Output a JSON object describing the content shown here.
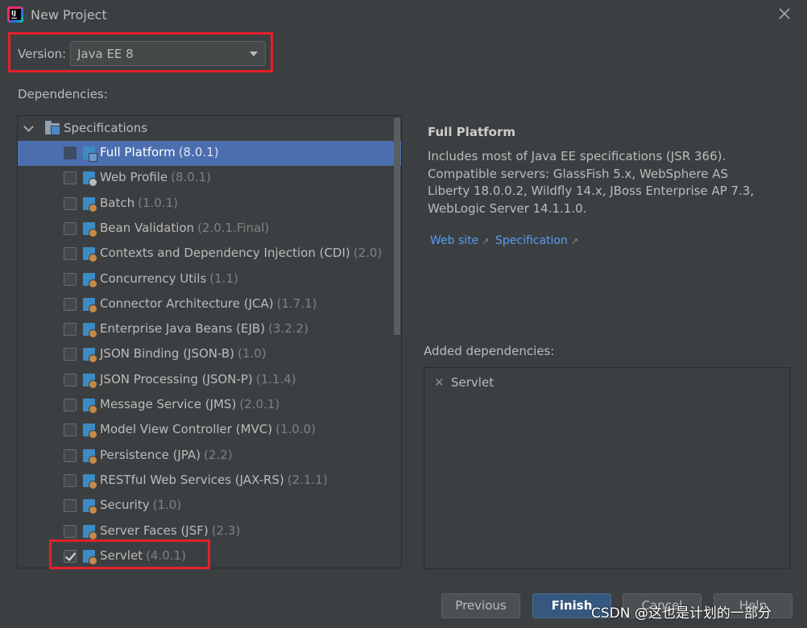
{
  "window": {
    "title": "New Project"
  },
  "version": {
    "label": "Version:",
    "value": "Java EE 8"
  },
  "dependencies_label": "Dependencies:",
  "tree": {
    "root_label": "Specifications",
    "items": [
      {
        "name": "Full Platform",
        "version": "(8.0.1)",
        "checked": false,
        "selected": true
      },
      {
        "name": "Web Profile",
        "version": "(8.0.1)",
        "checked": false,
        "selected": false
      },
      {
        "name": "Batch",
        "version": "(1.0.1)",
        "checked": false,
        "selected": false
      },
      {
        "name": "Bean Validation",
        "version": "(2.0.1.Final)",
        "checked": false,
        "selected": false
      },
      {
        "name": "Contexts and Dependency Injection (CDI)",
        "version": "(2.0)",
        "checked": false,
        "selected": false
      },
      {
        "name": "Concurrency Utils",
        "version": "(1.1)",
        "checked": false,
        "selected": false
      },
      {
        "name": "Connector Architecture (JCA)",
        "version": "(1.7.1)",
        "checked": false,
        "selected": false
      },
      {
        "name": "Enterprise Java Beans (EJB)",
        "version": "(3.2.2)",
        "checked": false,
        "selected": false
      },
      {
        "name": "JSON Binding (JSON-B)",
        "version": "(1.0)",
        "checked": false,
        "selected": false
      },
      {
        "name": "JSON Processing (JSON-P)",
        "version": "(1.1.4)",
        "checked": false,
        "selected": false
      },
      {
        "name": "Message Service (JMS)",
        "version": "(2.0.1)",
        "checked": false,
        "selected": false
      },
      {
        "name": "Model View Controller (MVC)",
        "version": "(1.0.0)",
        "checked": false,
        "selected": false
      },
      {
        "name": "Persistence (JPA)",
        "version": "(2.2)",
        "checked": false,
        "selected": false
      },
      {
        "name": "RESTful Web Services (JAX-RS)",
        "version": "(2.1.1)",
        "checked": false,
        "selected": false
      },
      {
        "name": "Security",
        "version": "(1.0)",
        "checked": false,
        "selected": false
      },
      {
        "name": "Server Faces (JSF)",
        "version": "(2.3)",
        "checked": false,
        "selected": false
      },
      {
        "name": "Servlet",
        "version": "(4.0.1)",
        "checked": true,
        "selected": false
      }
    ]
  },
  "detail": {
    "title": "Full Platform",
    "description": "Includes most of Java EE specifications (JSR 366). Compatible servers: GlassFish 5.x, WebSphere AS Liberty 18.0.0.2, Wildfly 14.x, JBoss Enterprise AP 7.3, WebLogic Server 14.1.1.0.",
    "links": {
      "website": "Web site",
      "specification": "Specification"
    }
  },
  "added": {
    "label": "Added dependencies:",
    "items": [
      "Servlet"
    ]
  },
  "buttons": {
    "previous": "Previous",
    "finish": "Finish",
    "cancel": "Cancel",
    "help": "Help"
  },
  "watermark": "CSDN @这也是计划的一部分",
  "colors": {
    "background": "#3c3f41",
    "selection": "#4b6eaf",
    "link": "#589df6",
    "highlight_box": "#e5202a",
    "primary_button": "#365880"
  }
}
